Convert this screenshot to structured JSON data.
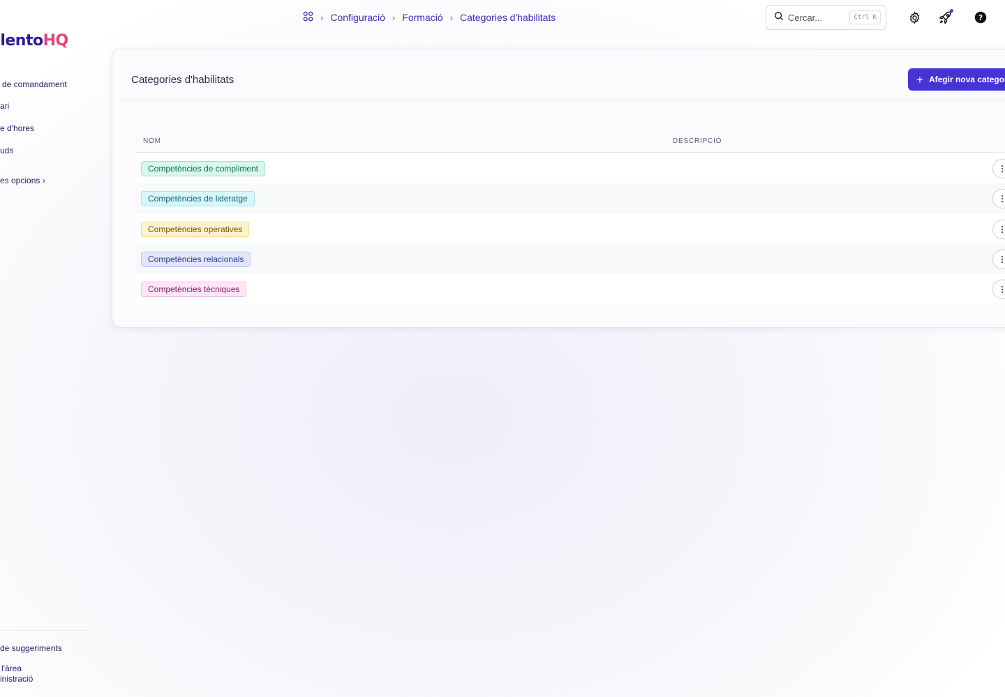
{
  "app": {
    "logo_main": "alento",
    "logo_accent": "HQ"
  },
  "sidebar": {
    "items": [
      {
        "label": "de comandament"
      },
      {
        "label": "ari"
      },
      {
        "label": "e d'hores"
      },
      {
        "label": "uds"
      },
      {
        "label": "es opcions ›"
      }
    ],
    "footer": [
      {
        "label": "de suggeriments"
      },
      {
        "label": "l'àrea"
      },
      {
        "label": "inistració"
      }
    ]
  },
  "header": {
    "breadcrumb": [
      "Configuració",
      "Formació",
      "Categories d'habilitats"
    ],
    "search": {
      "placeholder": "Cercar...",
      "shortcut": "Ctrl K"
    }
  },
  "card": {
    "title": "Categories d'habilitats",
    "add_button": "Afegir nova categoria",
    "columns": [
      "NOM",
      "DESCRIPCIÓ"
    ],
    "rows": [
      {
        "name": "Competències de compliment",
        "description": "",
        "bg": "#d9f7ee",
        "border": "#9fe3cc",
        "fg": "#0f6b52"
      },
      {
        "name": "Competències de lideratge",
        "description": "",
        "bg": "#d8f6fb",
        "border": "#9fe4f0",
        "fg": "#0e5f70"
      },
      {
        "name": "Competències operatives",
        "description": "",
        "bg": "#fff2cf",
        "border": "#f6d98a",
        "fg": "#7a5400"
      },
      {
        "name": "Competències relacionals",
        "description": "",
        "bg": "#e2e6fb",
        "border": "#bfc7f2",
        "fg": "#2f3a8f"
      },
      {
        "name": "Competències tècniques",
        "description": "",
        "bg": "#fde6f6",
        "border": "#f4bde3",
        "fg": "#8b1f6b"
      }
    ]
  }
}
